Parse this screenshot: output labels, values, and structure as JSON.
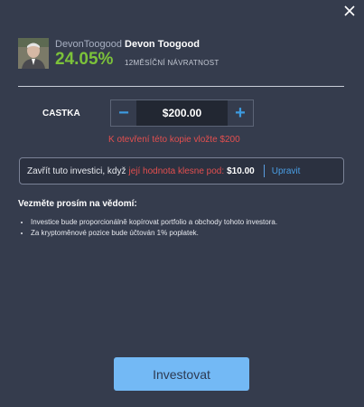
{
  "header": {
    "username": "DevonToogood",
    "full_name": "Devon Toogood",
    "return_pct": "24.05%",
    "return_label": "12MĚSÍČNÍ NÁVRATNOST"
  },
  "amount": {
    "label": "CASTKA",
    "minus": "−",
    "value": "$200.00",
    "plus": "+",
    "error": "K otevření této kopie vložte $200"
  },
  "stop_loss": {
    "prefix": "Zavřít tuto investici, když",
    "highlight": "její hodnota klesne pod:",
    "value": "$10.00",
    "edit_label": "Upravit"
  },
  "notes": {
    "title": "Vezměte prosím na vědomí:",
    "items": [
      "Investice bude proporcionálně kopírovat portfolio a obchody tohoto investora.",
      "Za kryptoměnové pozice bude účtován 1% poplatek."
    ]
  },
  "invest_button": "Investovat",
  "colors": {
    "background": "#353c4d",
    "positive": "#7cc23a",
    "error": "#e34f4f",
    "accent": "#3d9be0",
    "button": "#73b9f5"
  }
}
